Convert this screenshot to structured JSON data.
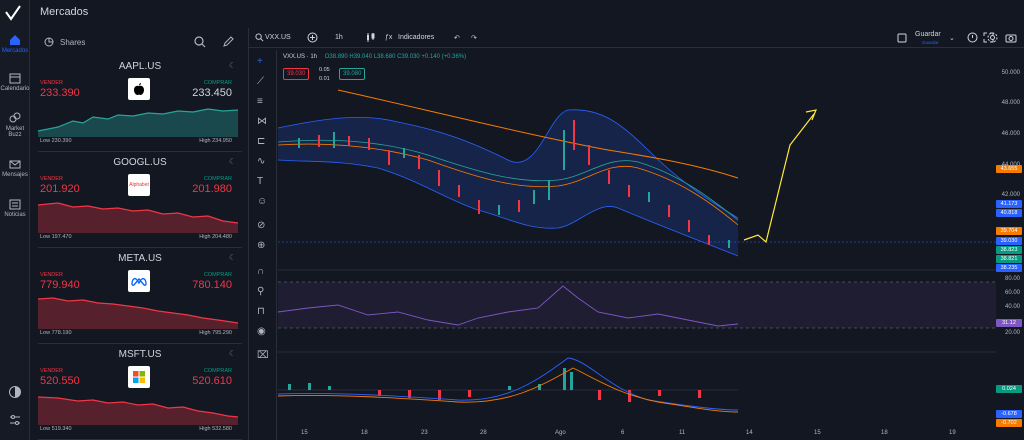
{
  "app": {
    "title": "Mercados"
  },
  "nav": [
    {
      "label": "Mercados",
      "icon": "home-icon"
    },
    {
      "label": "Calendario",
      "icon": "calendar-icon"
    },
    {
      "label": "Market Buzz",
      "icon": "buzz-icon"
    },
    {
      "label": "Mensajes",
      "icon": "mail-icon"
    },
    {
      "label": "Noticias",
      "icon": "news-icon"
    }
  ],
  "watchlist": {
    "title": "Shares",
    "cards": [
      {
        "symbol": "AAPL.US",
        "sell_label": "VENDER",
        "sell": "233.390",
        "buy_label": "COMPRAR",
        "buy": "233.450",
        "low": "Low 230.390",
        "high": "High 234.950",
        "logo": "apple-logo",
        "trend": "up"
      },
      {
        "symbol": "GOOGL.US",
        "sell_label": "VENDER",
        "sell": "201.920",
        "buy_label": "COMPRAR",
        "buy": "201.980",
        "low": "Low 197.470",
        "high": "High 204.480",
        "logo": "Alphabet",
        "trend": "down"
      },
      {
        "symbol": "META.US",
        "sell_label": "VENDER",
        "sell": "779.940",
        "buy_label": "COMPRAR",
        "buy": "780.140",
        "low": "Low 778.190",
        "high": "High 795.290",
        "logo": "meta-logo",
        "trend": "down"
      },
      {
        "symbol": "MSFT.US",
        "sell_label": "VENDER",
        "sell": "520.550",
        "buy_label": "COMPRAR",
        "buy": "520.610",
        "low": "Low 519.340",
        "high": "High 532.580",
        "logo": "microsoft-logo",
        "trend": "down"
      }
    ]
  },
  "chart": {
    "symbol": "VXX.US",
    "interval": "1h",
    "indicators_label": "Indicadores",
    "save_label": "Guardar",
    "save_sub": "Guardar",
    "legend_title": "VXX.US · 1h",
    "ohlc": "O38.890 H39.040 L38.680 C39.030 +0.140 (+0.36%)",
    "sell_box": "39.030",
    "spread_top": "0.05",
    "spread_bot": "0.01",
    "buy_box": "39.080",
    "price_axis": [
      "50.000",
      "48.000",
      "46.000",
      "44.000",
      "42.000",
      "40.000",
      "38.000",
      "36.000"
    ],
    "price_tags": [
      {
        "v": "43.655",
        "c": "#f57c00"
      },
      {
        "v": "41.173",
        "c": "#2962ff"
      },
      {
        "v": "40.818",
        "c": "#2962ff"
      },
      {
        "v": "39.704",
        "c": "#f57c00"
      },
      {
        "v": "39.030",
        "c": "#2962ff"
      },
      {
        "v": "38.823",
        "c": "#089981"
      },
      {
        "v": "38.821",
        "c": "#089981"
      },
      {
        "v": "38.235",
        "c": "#2962ff"
      }
    ],
    "rsi_axis": [
      "80.00",
      "60.00",
      "40.00",
      "20.00"
    ],
    "rsi_tag": "31.12",
    "macd_tags": [
      "0.024",
      "-0.678",
      "-0.702"
    ],
    "x_axis": [
      "15",
      "18",
      "23",
      "28",
      "Ago",
      "6",
      "11",
      "14",
      "15",
      "18",
      "19"
    ]
  }
}
